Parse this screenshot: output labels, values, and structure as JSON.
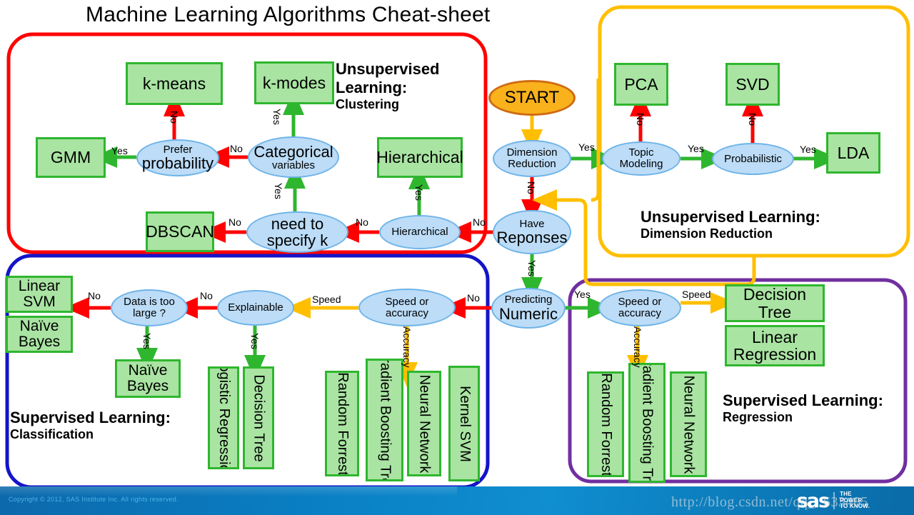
{
  "title": "Machine Learning Algorithms Cheat-sheet",
  "start": {
    "label": "START"
  },
  "groups": {
    "clustering": {
      "caption1": "Unsupervised",
      "caption2": "Learning:",
      "caption3": "Clustering",
      "color": "#ff0000"
    },
    "dimension": {
      "caption1": "Unsupervised Learning:",
      "caption2": "Dimension Reduction",
      "color": "#ffbf00"
    },
    "classification": {
      "caption1": "Supervised Learning:",
      "caption2": "Classification",
      "color": "#1414c8"
    },
    "regression": {
      "caption1": "Supervised Learning:",
      "caption2": "Regression",
      "color": "#7030a0"
    }
  },
  "decisions": {
    "dimension_reduction": {
      "line1": "Dimension",
      "line2": "Reduction"
    },
    "topic_modeling": {
      "line1": "Topic",
      "line2": "Modeling"
    },
    "probabilistic": {
      "line1": "Probabilistic"
    },
    "have_responses": {
      "line1": "Have",
      "line2": "Reponses"
    },
    "predicting_numeric": {
      "line1": "Predicting",
      "line2": "Numeric"
    },
    "hierarchical": {
      "line1": "Hierarchical"
    },
    "need_specify_k": {
      "line1": "need to",
      "line2": "specify k"
    },
    "categorical": {
      "line1": "Categorical",
      "line2": "variables"
    },
    "prefer_probability": {
      "line1": "Prefer",
      "line2": "probability"
    },
    "explainable": {
      "line1": "Explainable"
    },
    "data_too_large": {
      "line1": "Data is too",
      "line2": "large ?"
    },
    "speed_accuracy_cls": {
      "line1": "Speed or",
      "line2": "accuracy"
    },
    "speed_accuracy_reg": {
      "line1": "Speed or",
      "line2": "accuracy"
    }
  },
  "algorithms": {
    "k_means": "k-means",
    "k_modes": "k-modes",
    "gmm": "GMM",
    "hierarchical_box": "Hierarchical",
    "dbscan": "DBSCAN",
    "pca": "PCA",
    "svd": "SVD",
    "lda": "LDA",
    "linear_svm": "Linear SVM",
    "naive_bayes_left": "Naïve Bayes",
    "naive_bayes_mid": "Naïve Bayes",
    "logistic_regression": "Logistic Regression",
    "decision_tree_cls": "Decision Tree",
    "random_forrest_cls": "Random Forrest",
    "gradient_boosting_cls": "Gradient Boosting Tree",
    "neural_network_cls": "Neural Network",
    "kernel_svm": "Kernel SVM",
    "decision_tree_reg": "Decision Tree",
    "linear_regression": "Linear Regression",
    "random_forrest_reg": "Random Forrest",
    "gradient_boosting_reg": "Gradient Boosting Tree",
    "neural_network_reg": "Neural Network"
  },
  "edge_labels": {
    "dr_yes": "Yes",
    "dr_no": "No",
    "tm_no": "No",
    "tm_yes": "Yes",
    "prob_no": "No",
    "prob_yes": "Yes",
    "hr_no": "No",
    "hr_yes": "Yes",
    "hier_no": "No",
    "hier_yes": "Yes",
    "k_no": "No",
    "k_yes": "Yes",
    "cat_no": "No",
    "cat_yes": "Yes",
    "pp_yes": "Yes",
    "pp_no": "No",
    "pn_no": "No",
    "pn_yes": "Yes",
    "sa_cls_speed": "Speed",
    "sa_cls_accuracy": "Accuracy",
    "expl_no": "No",
    "expl_yes": "Yes",
    "dtl_no": "No",
    "dtl_yes": "Yes",
    "sa_reg_speed": "Speed",
    "sa_reg_accuracy": "Accuracy"
  },
  "footer": {
    "copyright": "Copyright © 2012, SAS Institute Inc. All rights reserved.",
    "logo_text": "sas",
    "tagline_1": "THE",
    "tagline_2": "POWER",
    "tagline_3": "TO KNOW."
  },
  "watermark": {
    "text": "http://blog.csdn.net/qq_..633405"
  },
  "colors": {
    "green_arrow": "#2fb62f",
    "red_arrow": "#ff0000",
    "orange_arrow": "#ffbf00",
    "box_fill": "#a9e4a2",
    "box_border": "#2fb62f",
    "ellipse_fill": "#bcdcf7",
    "ellipse_border": "#6fb4e8",
    "start_fill": "#f9b21c",
    "start_border": "#d06b12"
  }
}
